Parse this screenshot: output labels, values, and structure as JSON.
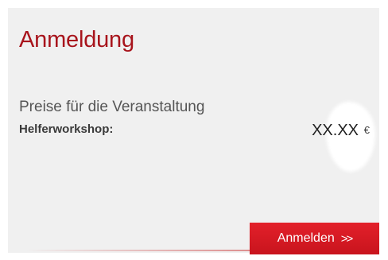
{
  "registration": {
    "title": "Anmeldung",
    "price_label": "Preise für die Veranstaltung",
    "event_name": "Helferworkshop:",
    "price": "XX.XX",
    "currency": "€",
    "button_label": "Anmelden",
    "button_arrows": ">>"
  },
  "colors": {
    "accent": "#c8141d",
    "title": "#a8141c",
    "panel_background": "#f0f0f0"
  }
}
